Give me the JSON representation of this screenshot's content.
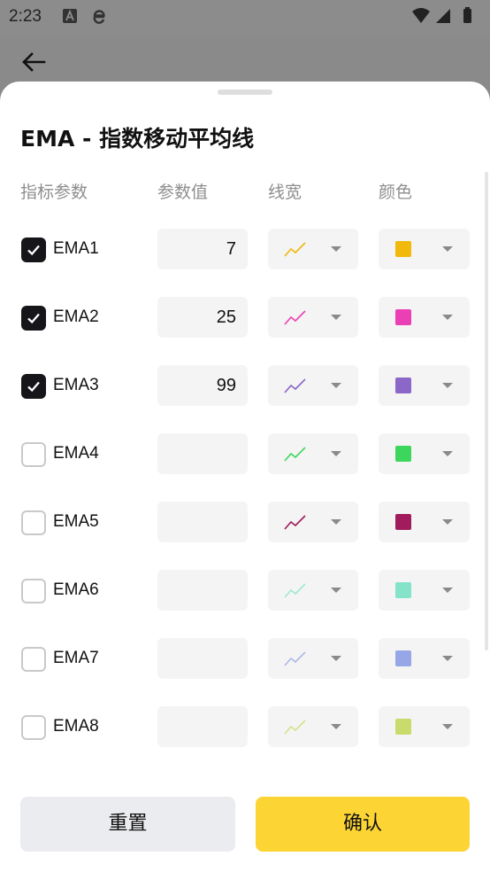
{
  "status_bar": {
    "time": "2:23"
  },
  "sheet": {
    "title": "EMA - 指数移动平均线",
    "headers": {
      "param": "指标参数",
      "value": "参数值",
      "width": "线宽",
      "color": "颜色"
    }
  },
  "rows": [
    {
      "label": "EMA1",
      "checked": true,
      "value": "7",
      "color": "#F0B90B"
    },
    {
      "label": "EMA2",
      "checked": true,
      "value": "25",
      "color": "#EB40B5"
    },
    {
      "label": "EMA3",
      "checked": true,
      "value": "99",
      "color": "#8B67C7"
    },
    {
      "label": "EMA4",
      "checked": false,
      "value": "",
      "color": "#3DD65C"
    },
    {
      "label": "EMA5",
      "checked": false,
      "value": "",
      "color": "#A01C5C"
    },
    {
      "label": "EMA6",
      "checked": false,
      "value": "",
      "color": "#84E3C9"
    },
    {
      "label": "EMA7",
      "checked": false,
      "value": "",
      "color": "#97A6E6"
    },
    {
      "label": "EMA8",
      "checked": false,
      "value": "",
      "color": "#C9DB6D"
    }
  ],
  "icons": {
    "back": "arrow-left-icon",
    "checkbox": "check-icon",
    "line_width": "line-chart-icon",
    "dropdown": "caret-down-icon"
  },
  "buttons": {
    "reset": "重置",
    "confirm": "确认"
  },
  "colors": {
    "confirm_bg": "#FCD535",
    "reset_bg": "#EBECEF",
    "checked_bg": "#16161A"
  }
}
